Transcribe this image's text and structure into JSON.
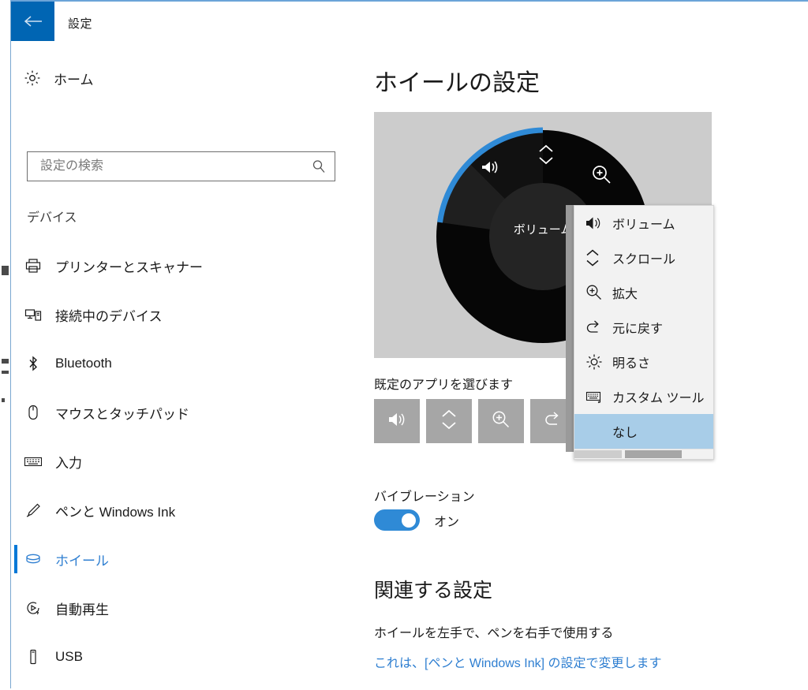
{
  "titlebar": {
    "back_icon": "arrow-left-icon",
    "title": "設定"
  },
  "sidebar": {
    "home": {
      "label": "ホーム",
      "icon": "gear-icon"
    },
    "search": {
      "placeholder": "設定の検索",
      "value": "",
      "icon": "search-icon"
    },
    "section_label": "デバイス",
    "items": [
      {
        "label": "プリンターとスキャナー",
        "icon": "printer-icon",
        "selected": false
      },
      {
        "label": "接続中のデバイス",
        "icon": "connected-devices-icon",
        "selected": false
      },
      {
        "label": "Bluetooth",
        "icon": "bluetooth-icon",
        "selected": false
      },
      {
        "label": "マウスとタッチパッド",
        "icon": "mouse-icon",
        "selected": false
      },
      {
        "label": "入力",
        "icon": "keyboard-icon",
        "selected": false
      },
      {
        "label": "ペンと Windows Ink",
        "icon": "pen-icon",
        "selected": false
      },
      {
        "label": "ホイール",
        "icon": "wheel-icon",
        "selected": true
      },
      {
        "label": "自動再生",
        "icon": "autoplay-icon",
        "selected": false
      },
      {
        "label": "USB",
        "icon": "usb-icon",
        "selected": false
      }
    ]
  },
  "main": {
    "page_title": "ホイールの設定",
    "dial": {
      "center_label": "ボリューム",
      "segments": [
        {
          "name": "volume",
          "icon": "volume-icon",
          "highlighted": true
        },
        {
          "name": "scroll",
          "icon": "scroll-icon",
          "highlighted": false
        },
        {
          "name": "zoom",
          "icon": "zoom-in-icon",
          "highlighted": false
        }
      ],
      "accent_color": "#2f8ad6",
      "background_color": "#cccccc"
    },
    "default_apps_label": "既定のアプリを選びます",
    "app_tiles": [
      {
        "name": "volume",
        "icon": "volume-icon"
      },
      {
        "name": "scroll",
        "icon": "scroll-icon"
      },
      {
        "name": "zoom",
        "icon": "zoom-in-icon"
      },
      {
        "name": "undo",
        "icon": "undo-icon"
      }
    ],
    "vibration": {
      "label": "バイブレーション",
      "state": "オン",
      "on": true
    },
    "related": {
      "title": "関連する設定",
      "description": "ホイールを左手で、ペンを右手で使用する",
      "link": "これは、[ペンと Windows Ink] の設定で変更します"
    }
  },
  "dropdown": {
    "items": [
      {
        "label": "ボリューム",
        "icon": "volume-icon",
        "highlighted": false
      },
      {
        "label": "スクロール",
        "icon": "scroll-icon",
        "highlighted": false
      },
      {
        "label": "拡大",
        "icon": "zoom-in-icon",
        "highlighted": false
      },
      {
        "label": "元に戻す",
        "icon": "undo-icon",
        "highlighted": false
      },
      {
        "label": "明るさ",
        "icon": "brightness-icon",
        "highlighted": false
      },
      {
        "label": "カスタム ツール",
        "icon": "custom-tool-icon",
        "highlighted": false
      },
      {
        "label": "なし",
        "icon": "none-icon",
        "highlighted": true
      }
    ]
  },
  "colors": {
    "accent": "#0078d7",
    "titlebar_back": "#0065b3",
    "link": "#2f7fd1",
    "highlight": "#a8cde8"
  }
}
